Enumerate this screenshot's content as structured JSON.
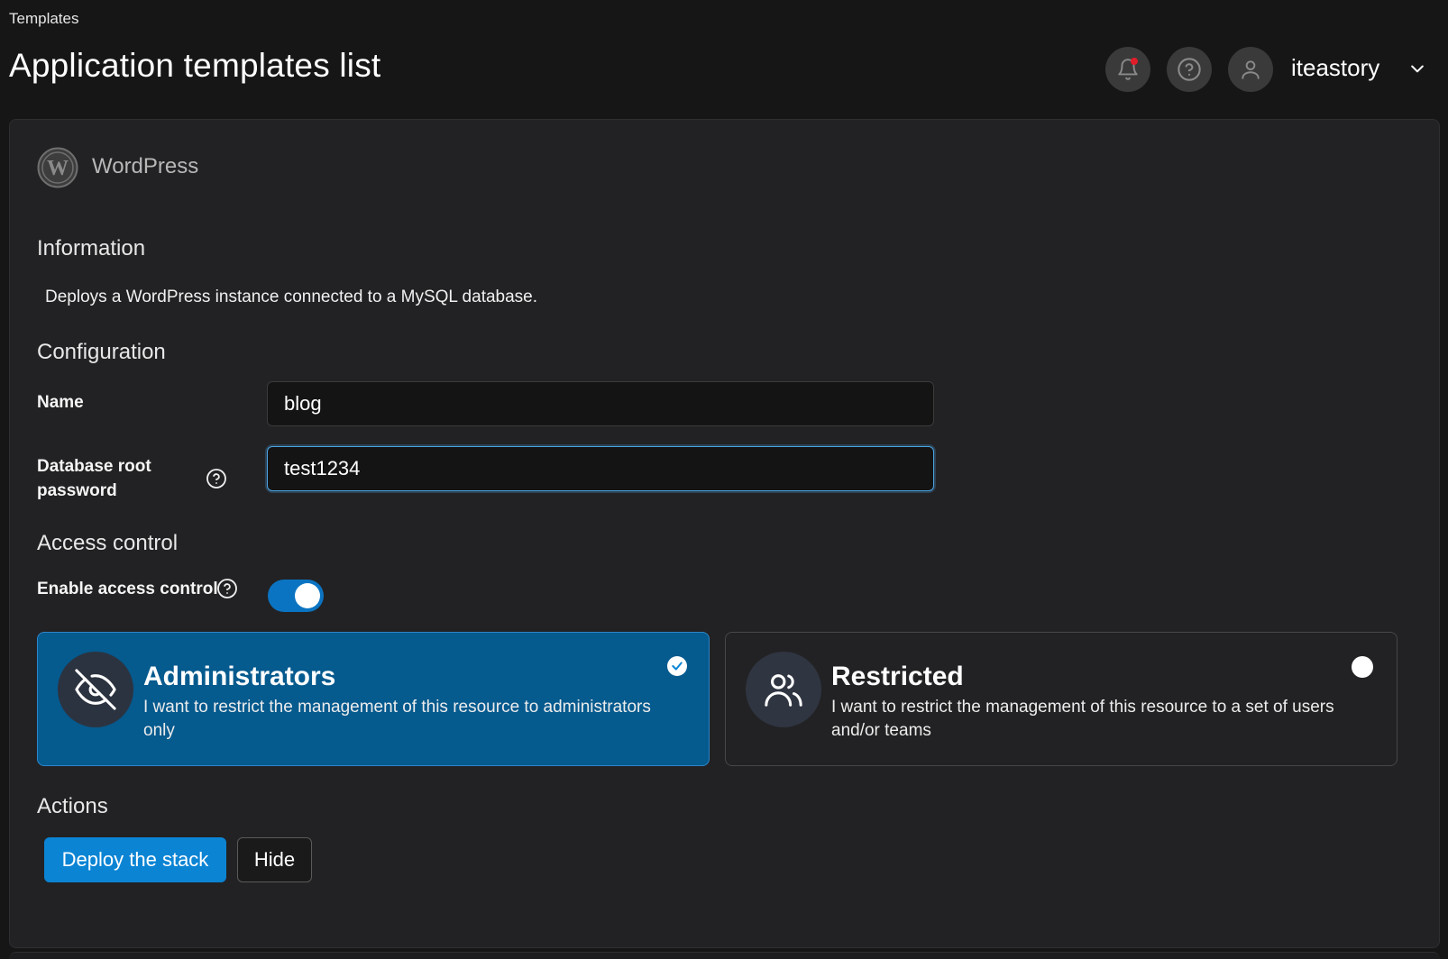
{
  "breadcrumb": "Templates",
  "page_title": "Application templates list",
  "header": {
    "notifications_icon": "bell-icon",
    "help_icon": "help-circle-icon",
    "user_icon": "user-icon",
    "username": "iteastory",
    "notification_dot_color": "#e11d2a"
  },
  "template": {
    "logo_icon": "wordpress-logo-icon",
    "name": "WordPress"
  },
  "sections": {
    "information": "Information",
    "configuration": "Configuration",
    "access_control": "Access control",
    "actions": "Actions"
  },
  "information_text": "Deploys a WordPress instance connected to a MySQL database.",
  "config": {
    "name_label": "Name",
    "name_value": "blog",
    "db_password_label": "Database root password",
    "db_password_value": "test1234"
  },
  "access": {
    "enable_label": "Enable access control",
    "enabled": true,
    "options": [
      {
        "title": "Administrators",
        "description": "I want to restrict the management of this resource to administrators only",
        "icon": "eye-off-icon",
        "selected": true
      },
      {
        "title": "Restricted",
        "description": "I want to restrict the management of this resource to a set of users and/or teams",
        "icon": "users-icon",
        "selected": false
      }
    ]
  },
  "actions": {
    "deploy_label": "Deploy the stack",
    "hide_label": "Hide"
  },
  "colors": {
    "accent": "#0b84d4",
    "selected_card": "#055a8e",
    "background": "#161616",
    "panel": "#222224"
  }
}
